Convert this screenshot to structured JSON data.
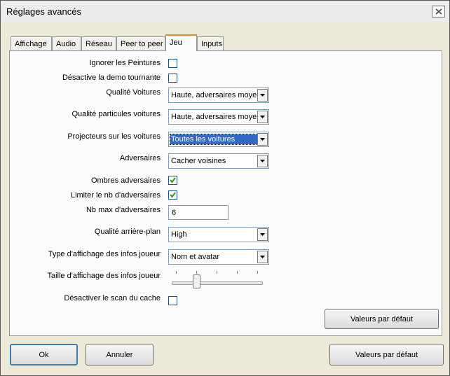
{
  "window": {
    "title": "Réglages avancés"
  },
  "tabs": [
    "Affichage",
    "Audio",
    "Réseau",
    "Peer to peer",
    "Jeu",
    "Inputs"
  ],
  "active_tab": "Jeu",
  "settings": {
    "ignore_paintings": {
      "label": "Ignorer les Peintures",
      "checked": false
    },
    "disable_demo": {
      "label": "Désactive la demo tournante",
      "checked": false
    },
    "car_quality": {
      "label": "Qualité Voitures",
      "value": "Haute, adversaires moyen"
    },
    "car_particles": {
      "label": "Qualité particules voitures",
      "value": "Haute, adversaires moyen"
    },
    "car_projectors": {
      "label": "Projecteurs sur les voitures",
      "value": "Toutes les voitures"
    },
    "opponents": {
      "label": "Adversaires",
      "value": "Cacher voisines"
    },
    "opponent_shadows": {
      "label": "Ombres adversaires",
      "checked": true
    },
    "limit_opponents": {
      "label": "Limiter le nb d'adversaires",
      "checked": true
    },
    "max_opponents": {
      "label": "Nb max d'adversaires",
      "value": "6"
    },
    "background_quality": {
      "label": "Qualité arrière-plan",
      "value": "High"
    },
    "player_info_type": {
      "label": "Type d'affichage des infos joueur",
      "value": "Nom et avatar"
    },
    "player_info_size": {
      "label": "Taille d'affichage des infos joueur",
      "level": 0.25
    },
    "disable_cache_scan": {
      "label": "Désactiver le scan du cache",
      "checked": false
    }
  },
  "buttons": {
    "panel_defaults": "Valeurs par défaut",
    "ok": "Ok",
    "cancel": "Annuler",
    "defaults": "Valeurs par défaut"
  },
  "icons": {
    "close": "close-icon",
    "dropdown": "chevron-down-icon",
    "check": "check-icon"
  },
  "colors": {
    "tab_accent": "#e68b2c",
    "selection": "#316ac5",
    "checkmark": "#21a121"
  }
}
